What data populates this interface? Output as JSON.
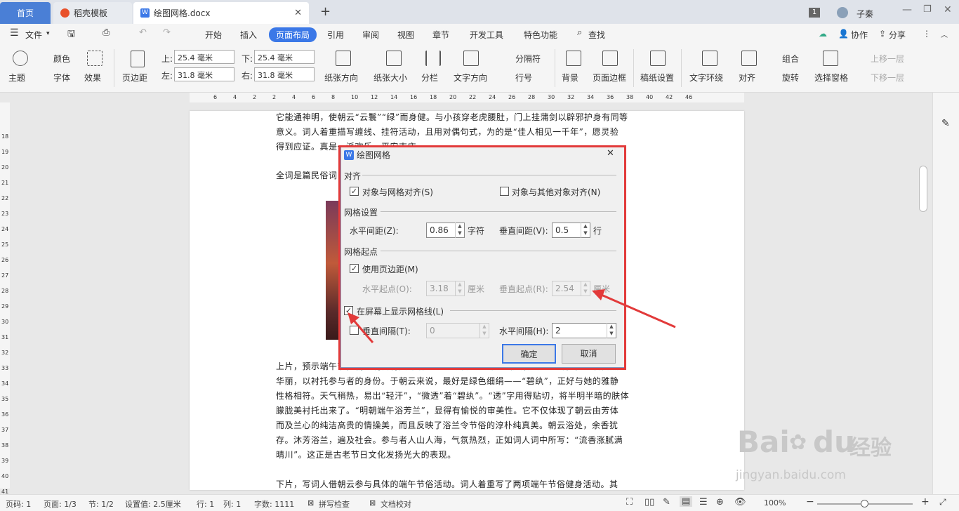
{
  "tabs": {
    "home": "首页",
    "templates": "稻壳模板",
    "doc": "绘图网格.docx",
    "badge": "1",
    "user": "子秦"
  },
  "menubar": {
    "file": "文件",
    "items": [
      "开始",
      "插入",
      "页面布局",
      "引用",
      "审阅",
      "视图",
      "章节",
      "开发工具",
      "特色功能"
    ],
    "find": "查找",
    "collab": "协作",
    "share": "分享"
  },
  "ribbon": {
    "theme": "主题",
    "color": "颜色",
    "font": "字体",
    "effect": "效果",
    "margin": "页边距",
    "top_label": "上:",
    "top_val": "25.4 毫米",
    "bottom_label": "下:",
    "bottom_val": "25.4 毫米",
    "left_label": "左:",
    "left_val": "31.8 毫米",
    "right_label": "右:",
    "right_val": "31.8 毫米",
    "orient": "纸张方向",
    "size": "纸张大小",
    "columns": "分栏",
    "textdir": "文字方向",
    "sep": "分隔符",
    "lineno": "行号",
    "bg": "背景",
    "border": "页面边框",
    "grid": "稿纸设置",
    "wrap": "文字环绕",
    "align": "对齐",
    "group": "组合",
    "rotate": "旋转",
    "pane": "选择窗格",
    "up": "上移一层",
    "down": "下移一层"
  },
  "ruler_h": [
    "6",
    "4",
    "2",
    "2",
    "4",
    "6",
    "8",
    "10",
    "12",
    "14",
    "16",
    "18",
    "20",
    "22",
    "24",
    "26",
    "28",
    "30",
    "32",
    "34",
    "36",
    "38",
    "40",
    "42",
    "46"
  ],
  "ruler_v": [
    "18",
    "19",
    "20",
    "21",
    "22",
    "23",
    "24",
    "25",
    "26",
    "27",
    "28",
    "29",
    "30",
    "31",
    "32",
    "33",
    "34",
    "35",
    "36",
    "37",
    "38",
    "39",
    "40",
    "41",
    "42"
  ],
  "doc": {
    "p1": [
      "它能通神明，使朝云“云鬟”“绿”而身健。与小孩穿老虎腰肚，门上挂蒲剑以辟邪护身有同等",
      "意义。词人着重描写缠线、挂符活动，且用对偶句式，为的是“佳人相见一千年”，愿灵验",
      "得到应证。真是一派欢乐，平安吉庆。"
    ],
    "p2": "全词是篇民俗词，也是反映端午节在宋代民间的习俗，为研究宋代风俗提供了宝贵的资料。",
    "p3": [
      "上片，预示端午节，朝云明日将要沐浴的兰汤与碧纨衣饰。“彩线轻缠红玉臂”，写着自然",
      "华丽，以衬托参与者的身份。于朝云来说，最好是绿色细绢——“碧纨”，正好与她的雅静",
      "性格相符。天气稍热，易出“轻汗”，“微透”着“碧纨”。“透”字用得贴切，将半明半暗的肤体",
      "朦胧美衬托出来了。“明朝端午浴芳兰”，显得有愉悦的审美性。它不仅体现了朝云由芳体",
      "而及兰心的纯洁高贵的情操美，而且反映了浴兰令节俗的淳朴纯真美。朝云浴处，余香犹",
      "存。沐芳浴兰，遍及社会。参与者人山人海，气氛热烈，正如词人词中所写：“流香涨腻满",
      "晴川”。这正是古老节日文化发扬光大的表现。"
    ],
    "p4": "下片，写词人借朝云参与具体的端午节俗活动。词人着重写了两项端午节俗健身活动。其"
  },
  "dialog": {
    "title": "绘图网格",
    "align_group": "对齐",
    "snap_grid": "对象与网格对齐(S)",
    "snap_obj": "对象与其他对象对齐(N)",
    "grid_settings": "网格设置",
    "h_spacing": "水平间距(Z):",
    "h_spacing_val": "0.86",
    "h_unit": "字符",
    "v_spacing": "垂直间距(V):",
    "v_spacing_val": "0.5",
    "v_unit": "行",
    "origin": "网格起点",
    "use_margin": "使用页边距(M)",
    "h_origin": "水平起点(O):",
    "h_origin_val": "3.18",
    "h_origin_unit": "厘米",
    "v_origin": "垂直起点(R):",
    "v_origin_val": "2.54",
    "v_origin_unit": "厘米",
    "show_grid": "在屏幕上显示网格线(L)",
    "vert_every": "垂直间隔(T):",
    "vert_every_val": "0",
    "horiz_every": "水平间隔(H):",
    "horiz_every_val": "2",
    "ok": "确定",
    "cancel": "取消"
  },
  "status": {
    "page": "页码: 1",
    "pages": "页面: 1/3",
    "section": "节: 1/2",
    "setting": "设置值: 2.5厘米",
    "row": "行: 1",
    "col": "列: 1",
    "words": "字数: 1111",
    "spell": "拼写检查",
    "proof": "文档校对",
    "zoom": "100%"
  },
  "watermark": {
    "brand": "Bai",
    "brand2": "du",
    "cn": "经验",
    "url": "jingyan.baidu.com"
  }
}
